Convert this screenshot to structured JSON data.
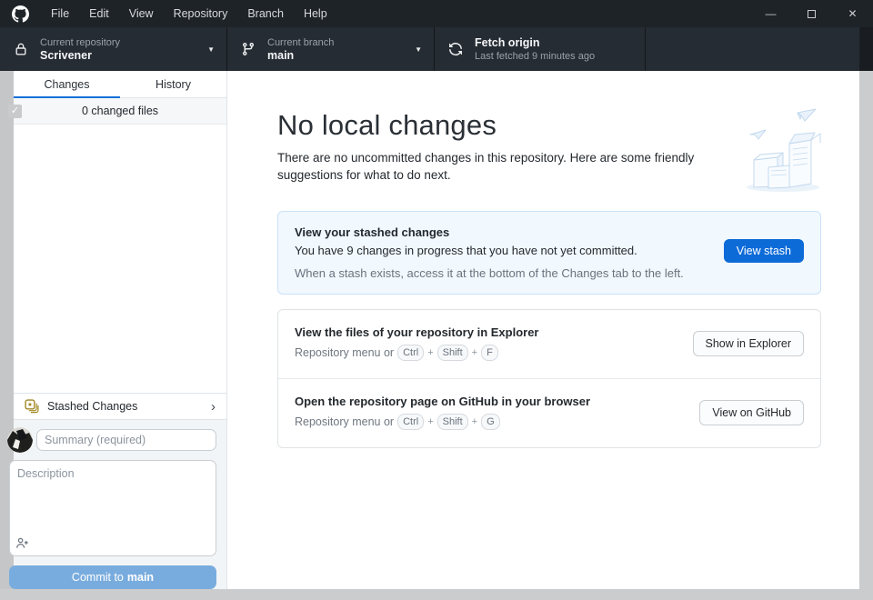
{
  "menubar": {
    "items": [
      "File",
      "Edit",
      "View",
      "Repository",
      "Branch",
      "Help"
    ]
  },
  "window_controls": {
    "minimize": "—",
    "close": "✕"
  },
  "toolbar": {
    "repo": {
      "label": "Current repository",
      "value": "Scrivener",
      "caret": "▼"
    },
    "branch": {
      "label": "Current branch",
      "value": "main",
      "caret": "▼"
    },
    "fetch": {
      "title": "Fetch origin",
      "subtitle": "Last fetched 9 minutes ago"
    }
  },
  "sidebar": {
    "tabs": [
      {
        "label": "Changes"
      },
      {
        "label": "History"
      }
    ],
    "changed_files": "0 changed files",
    "checkbox_glyph": "✓",
    "stashed_changes_label": "Stashed Changes",
    "stash_chevron": "›",
    "commit": {
      "summary_placeholder": "Summary (required)",
      "description_placeholder": "Description",
      "button_prefix": "Commit to",
      "button_branch": "main"
    }
  },
  "main": {
    "title": "No local changes",
    "subtitle": "There are no uncommitted changes in this repository. Here are some friendly suggestions for what to do next.",
    "stash_card": {
      "title": "View your stashed changes",
      "line1": "You have 9 changes in progress that you have not yet committed.",
      "line2": "When a stash exists, access it at the bottom of the Changes tab to the left.",
      "button": "View stash"
    },
    "key_separator": "+",
    "suggestions": [
      {
        "title": "View the files of your repository in Explorer",
        "hint_prefix": "Repository menu or",
        "keys": [
          "Ctrl",
          "Shift",
          "F"
        ],
        "button": "Show in Explorer"
      },
      {
        "title": "Open the repository page on GitHub in your browser",
        "hint_prefix": "Repository menu or",
        "keys": [
          "Ctrl",
          "Shift",
          "G"
        ],
        "button": "View on GitHub"
      }
    ]
  },
  "colors": {
    "titlebar": "#1e2328",
    "toolbar": "#262c33",
    "accent_blue": "#0d6bd8",
    "active_tab_underline": "#0f6fd7",
    "stash_card_bg": "#f1f8fe",
    "stash_card_border": "#c9e1f8",
    "commit_button_disabled": "#79acde",
    "stash_icon_gold": "#a08821",
    "desktop_frame_gray": "#cbcccd"
  }
}
